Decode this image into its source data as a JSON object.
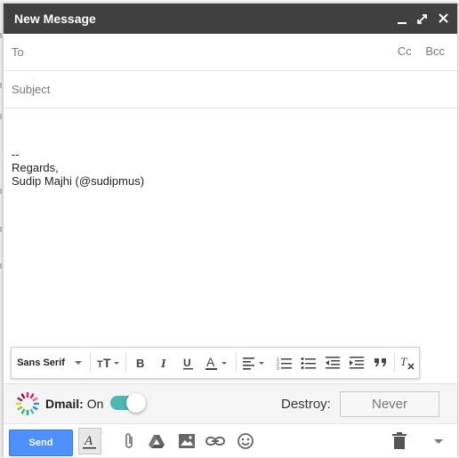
{
  "window": {
    "title": "New Message",
    "minimize_icon": "minimize-icon",
    "popout_icon": "popout-icon",
    "close_icon": "close-icon"
  },
  "to": {
    "label": "To",
    "cc": "Cc",
    "bcc": "Bcc"
  },
  "subject": {
    "placeholder": "Subject"
  },
  "body": {
    "lines": [
      "--",
      "Regards,",
      "Sudip Majhi (@sudipmus)"
    ]
  },
  "format_toolbar": {
    "font": "Sans Serif",
    "icons": [
      "font-size-icon",
      "bold-icon",
      "italic-icon",
      "underline-icon",
      "text-color-icon",
      "align-icon",
      "numbered-list-icon",
      "bulleted-list-icon",
      "indent-less-icon",
      "indent-more-icon",
      "quote-icon",
      "remove-formatting-icon"
    ]
  },
  "dmail": {
    "brand": "Dmail:",
    "state": "On",
    "enabled": true,
    "destroy_label": "Destroy:",
    "destroy_value": "Never",
    "accent_color": "#4cb8b2"
  },
  "bottom_toolbar": {
    "send_label": "Send",
    "send_color": "#4d90fe",
    "icons": [
      "formatting-icon",
      "attach-icon",
      "drive-icon",
      "photo-icon",
      "link-icon",
      "emoji-icon",
      "trash-icon",
      "more-options-icon"
    ]
  }
}
